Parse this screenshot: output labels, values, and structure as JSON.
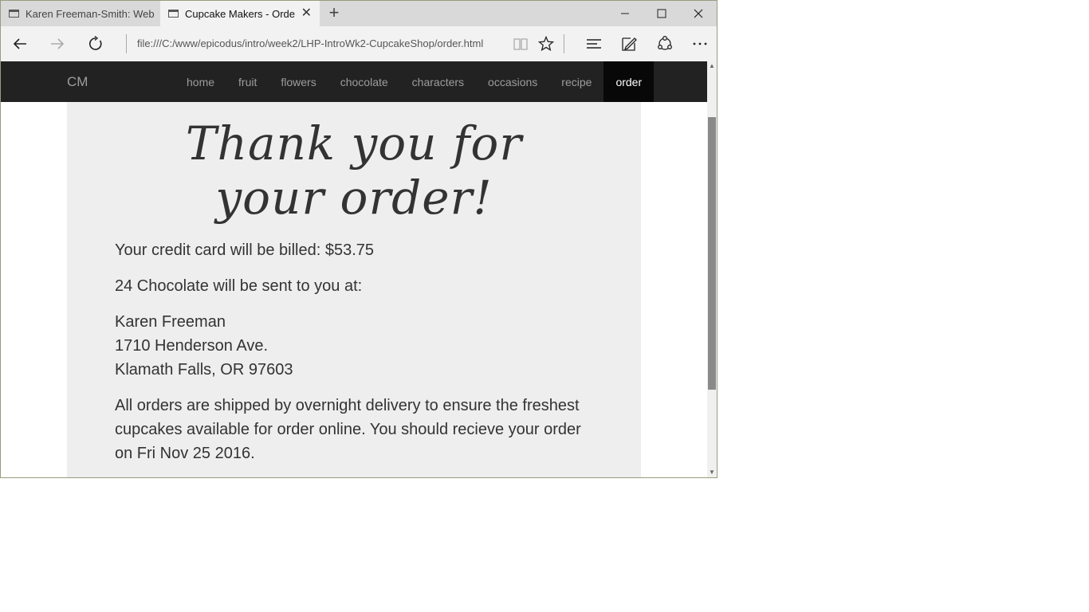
{
  "tabs": [
    {
      "title": "Karen Freeman-Smith: Web"
    },
    {
      "title": "Cupcake Makers - Orde"
    }
  ],
  "address": {
    "url": "file:///C:/www/epicodus/intro/week2/LHP-IntroWk2-CupcakeShop/order.html"
  },
  "site": {
    "brand": "CM",
    "nav": [
      "home",
      "fruit",
      "flowers",
      "chocolate",
      "characters",
      "occasions",
      "recipe",
      "order"
    ],
    "active_nav": "order"
  },
  "order": {
    "heading_line1": "Thank you for",
    "heading_line2": "your order!",
    "billing": "Your credit card will be billed: $53.75",
    "shipping_intro": "24 Chocolate will be sent to you at:",
    "address_name": "Karen Freeman",
    "address_street": "1710 Henderson Ave.",
    "address_city": "Klamath Falls, OR 97603",
    "delivery_note": "All orders are shipped by overnight delivery to ensure the freshest cupcakes available for order online. You should recieve your order on Fri Nov 25 2016."
  },
  "icons": {
    "back": "back-arrow-icon",
    "forward": "forward-arrow-icon",
    "refresh": "refresh-icon",
    "reading": "reading-view-icon",
    "favorite": "star-icon",
    "hub": "hub-icon",
    "note": "web-note-icon",
    "share": "share-icon",
    "more": "more-icon"
  }
}
